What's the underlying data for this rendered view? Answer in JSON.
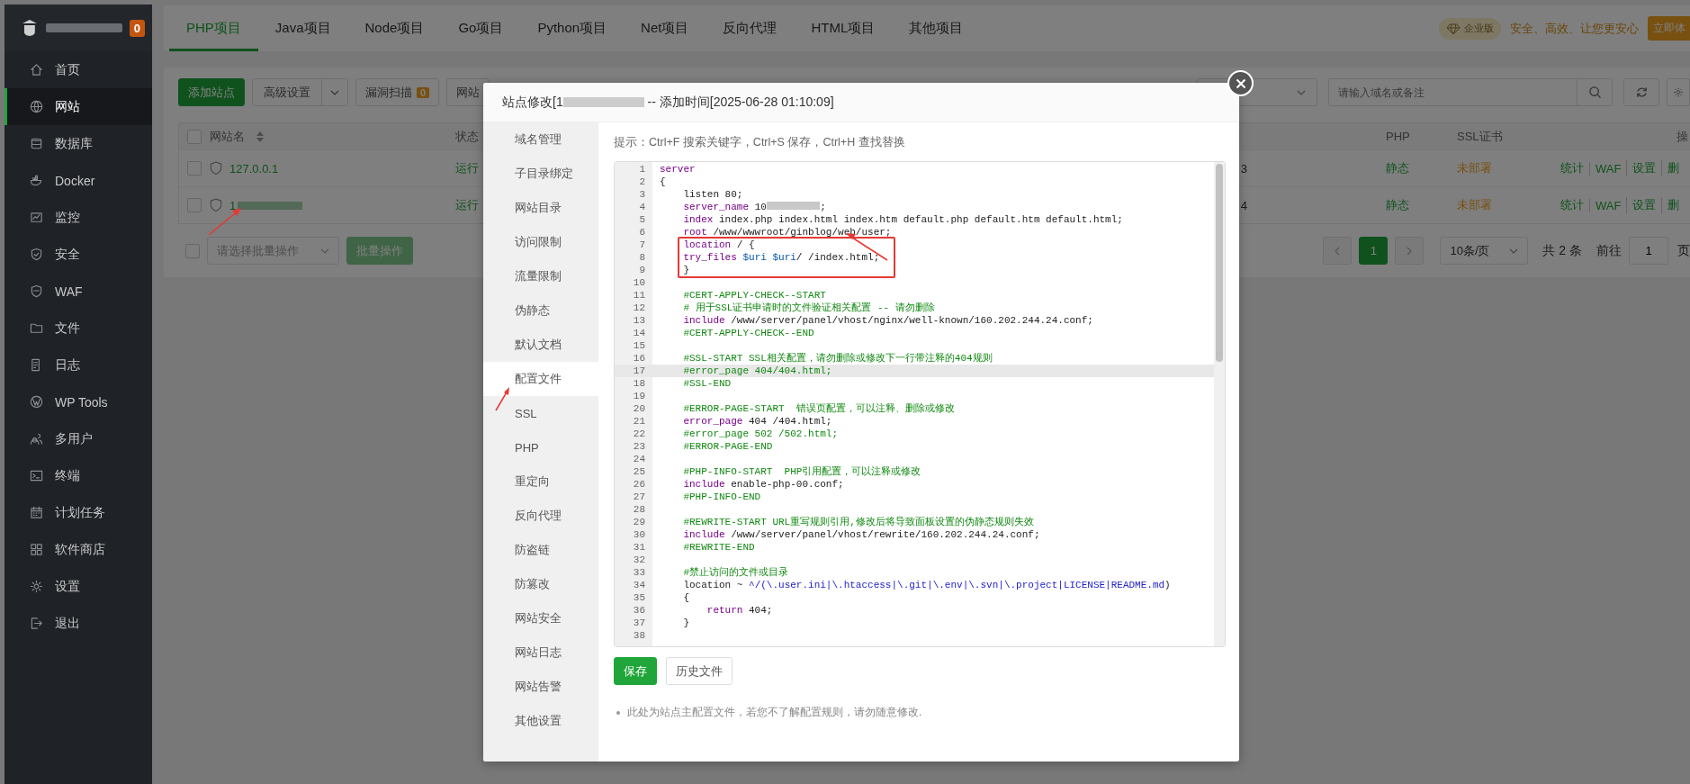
{
  "sidebar": {
    "badge": "0",
    "items": [
      {
        "label": "首页",
        "selected": false
      },
      {
        "label": "网站",
        "selected": true
      },
      {
        "label": "数据库",
        "selected": false
      },
      {
        "label": "Docker",
        "selected": false
      },
      {
        "label": "监控",
        "selected": false
      },
      {
        "label": "安全",
        "selected": false
      },
      {
        "label": "WAF",
        "selected": false
      },
      {
        "label": "文件",
        "selected": false
      },
      {
        "label": "日志",
        "selected": false
      },
      {
        "label": "WP Tools",
        "selected": false
      },
      {
        "label": "多用户",
        "selected": false
      },
      {
        "label": "终端",
        "selected": false
      },
      {
        "label": "计划任务",
        "selected": false
      },
      {
        "label": "软件商店",
        "selected": false
      },
      {
        "label": "设置",
        "selected": false
      },
      {
        "label": "退出",
        "selected": false
      }
    ]
  },
  "project_tabs": [
    {
      "label": "PHP项目",
      "selected": true
    },
    {
      "label": "Java项目",
      "selected": false
    },
    {
      "label": "Node项目",
      "selected": false
    },
    {
      "label": "Go项目",
      "selected": false
    },
    {
      "label": "Python项目",
      "selected": false
    },
    {
      "label": "Net项目",
      "selected": false
    },
    {
      "label": "反向代理",
      "selected": false
    },
    {
      "label": "HTML项目",
      "selected": false
    },
    {
      "label": "其他项目",
      "selected": false
    }
  ],
  "promo": {
    "badge": "企业版",
    "text": "安全、高效、让您更安心",
    "button": "立即体"
  },
  "toolbar": {
    "add_button": "添加站点",
    "advanced_button": "高级设置",
    "scan_button": "漏洞扫描",
    "scan_count": "0",
    "site_button": "网站",
    "search": {
      "placeholder": "请输入域名或备注"
    }
  },
  "table": {
    "select_all": {
      "checked": false
    },
    "columns": {
      "name": "网站名",
      "status": "状态",
      "php": "PHP",
      "ssl": "SSL证书",
      "actions": "操"
    },
    "rows": [
      {
        "checked": false,
        "name": "127.0.0.1",
        "name_redacted": false,
        "status": "运行",
        "column_4": "3",
        "php": "静态",
        "ssl": "未部署",
        "actions": [
          "统计",
          "WAF",
          "设置",
          "删"
        ]
      },
      {
        "checked": false,
        "name": "1",
        "name_redacted": true,
        "status": "运行",
        "column_4": "4",
        "php": "静态",
        "ssl": "未部署",
        "actions": [
          "统计",
          "WAF",
          "设置",
          "删"
        ]
      }
    ]
  },
  "batch": {
    "checked": false,
    "placeholder": "请选择批量操作",
    "button": "批量操作"
  },
  "pagination": {
    "pages": [
      {
        "label": "1",
        "selected": true
      }
    ],
    "page_size": "10条/页",
    "total": "共 2 条",
    "goto_label": "前往",
    "goto_value": "1",
    "page_suffix": "页"
  },
  "modal": {
    "title_prefix": "站点修改[1",
    "title_suffix": " -- 添加时间[2025-06-28 01:10:09]",
    "menu": [
      {
        "label": "域名管理",
        "selected": false
      },
      {
        "label": "子目录绑定",
        "selected": false
      },
      {
        "label": "网站目录",
        "selected": false
      },
      {
        "label": "访问限制",
        "selected": false
      },
      {
        "label": "流量限制",
        "selected": false
      },
      {
        "label": "伪静态",
        "selected": false
      },
      {
        "label": "默认文档",
        "selected": false
      },
      {
        "label": "配置文件",
        "selected": true
      },
      {
        "label": "SSL",
        "selected": false
      },
      {
        "label": "PHP",
        "selected": false
      },
      {
        "label": "重定向",
        "selected": false
      },
      {
        "label": "反向代理",
        "selected": false
      },
      {
        "label": "防盗链",
        "selected": false
      },
      {
        "label": "防篡改",
        "selected": false
      },
      {
        "label": "网站安全",
        "selected": false
      },
      {
        "label": "网站日志",
        "selected": false
      },
      {
        "label": "网站告警",
        "selected": false
      },
      {
        "label": "其他设置",
        "selected": false
      }
    ],
    "hint": "提示：Ctrl+F 搜索关键字，Ctrl+S 保存，Ctrl+H 查找替换",
    "code_lines": [
      {
        "number": "1",
        "active": false,
        "boxed": false,
        "tokens": [
          {
            "kind": "keyword",
            "text": "server"
          }
        ]
      },
      {
        "number": "2",
        "active": false,
        "boxed": false,
        "tokens": [
          {
            "kind": "plain",
            "text": "{"
          }
        ]
      },
      {
        "number": "3",
        "active": false,
        "boxed": false,
        "tokens": [
          {
            "kind": "plain",
            "text": "    listen 80;"
          }
        ]
      },
      {
        "number": "4",
        "active": false,
        "boxed": false,
        "tokens": [
          {
            "kind": "keyword",
            "text": "    server_name"
          },
          {
            "kind": "plain",
            "text": " 10"
          },
          {
            "kind": "redacted"
          },
          {
            "kind": "plain",
            "text": ";"
          }
        ]
      },
      {
        "number": "5",
        "active": false,
        "boxed": false,
        "tokens": [
          {
            "kind": "keyword",
            "text": "    index"
          },
          {
            "kind": "plain",
            "text": " index.php index.html index.htm default.php default.htm default.html;"
          }
        ]
      },
      {
        "number": "6",
        "active": false,
        "boxed": false,
        "tokens": [
          {
            "kind": "keyword",
            "text": "    root"
          },
          {
            "kind": "plain",
            "text": " /www/wwwroot/ginblog/web/user;"
          }
        ]
      },
      {
        "number": "7",
        "active": false,
        "boxed": true,
        "tokens": [
          {
            "kind": "keyword",
            "text": "    location"
          },
          {
            "kind": "plain",
            "text": " / {"
          }
        ]
      },
      {
        "number": "8",
        "active": false,
        "boxed": true,
        "tokens": [
          {
            "kind": "keyword",
            "text": "    try_files"
          },
          {
            "kind": "variable",
            "text": " $uri"
          },
          {
            "kind": "variable",
            "text": " $uri"
          },
          {
            "kind": "plain",
            "text": "/ /index.html;"
          }
        ]
      },
      {
        "number": "9",
        "active": false,
        "boxed": true,
        "tokens": [
          {
            "kind": "plain",
            "text": "    }"
          }
        ]
      },
      {
        "number": "10",
        "active": false,
        "boxed": false
      },
      {
        "number": "11",
        "active": false,
        "boxed": false,
        "tokens": [
          {
            "kind": "comment",
            "text": "    #CERT-APPLY-CHECK--START"
          }
        ]
      },
      {
        "number": "12",
        "active": false,
        "boxed": false,
        "tokens": [
          {
            "kind": "comment",
            "text": "    # 用于SSL证书申请时的文件验证相关配置 -- 请勿删除"
          }
        ]
      },
      {
        "number": "13",
        "active": false,
        "boxed": false,
        "tokens": [
          {
            "kind": "keyword",
            "text": "    include"
          },
          {
            "kind": "plain",
            "text": " /www/server/panel/vhost/nginx/well-known/160.202.244.24.conf;"
          }
        ]
      },
      {
        "number": "14",
        "active": false,
        "boxed": false,
        "tokens": [
          {
            "kind": "comment",
            "text": "    #CERT-APPLY-CHECK--END"
          }
        ]
      },
      {
        "number": "15",
        "active": false,
        "boxed": false
      },
      {
        "number": "16",
        "active": false,
        "boxed": false,
        "tokens": [
          {
            "kind": "comment",
            "text": "    #SSL-START SSL相关配置，请勿删除或修改下一行带注释的404规则"
          }
        ]
      },
      {
        "number": "17",
        "active": true,
        "boxed": false,
        "tokens": [
          {
            "kind": "comment",
            "text": "    #error_page 404/404.html;"
          }
        ]
      },
      {
        "number": "18",
        "active": false,
        "boxed": false,
        "tokens": [
          {
            "kind": "comment",
            "text": "    #SSL-END"
          }
        ]
      },
      {
        "number": "19",
        "active": false,
        "boxed": false
      },
      {
        "number": "20",
        "active": false,
        "boxed": false,
        "tokens": [
          {
            "kind": "comment",
            "text": "    #ERROR-PAGE-START  错误页配置，可以注释、删除或修改"
          }
        ]
      },
      {
        "number": "21",
        "active": false,
        "boxed": false,
        "tokens": [
          {
            "kind": "keyword",
            "text": "    error_page"
          },
          {
            "kind": "plain",
            "text": " 404 /404.html;"
          }
        ]
      },
      {
        "number": "22",
        "active": false,
        "boxed": false,
        "tokens": [
          {
            "kind": "comment",
            "text": "    #error_page 502 /502.html;"
          }
        ]
      },
      {
        "number": "23",
        "active": false,
        "boxed": false,
        "tokens": [
          {
            "kind": "comment",
            "text": "    #ERROR-PAGE-END"
          }
        ]
      },
      {
        "number": "24",
        "active": false,
        "boxed": false
      },
      {
        "number": "25",
        "active": false,
        "boxed": false,
        "tokens": [
          {
            "kind": "comment",
            "text": "    #PHP-INFO-START  PHP引用配置，可以注释或修改"
          }
        ]
      },
      {
        "number": "26",
        "active": false,
        "boxed": false,
        "tokens": [
          {
            "kind": "keyword",
            "text": "    include"
          },
          {
            "kind": "plain",
            "text": " enable-php-00.conf;"
          }
        ]
      },
      {
        "number": "27",
        "active": false,
        "boxed": false,
        "tokens": [
          {
            "kind": "comment",
            "text": "    #PHP-INFO-END"
          }
        ]
      },
      {
        "number": "28",
        "active": false,
        "boxed": false
      },
      {
        "number": "29",
        "active": false,
        "boxed": false,
        "tokens": [
          {
            "kind": "comment",
            "text": "    #REWRITE-START URL重写规则引用,修改后将导致面板设置的伪静态规则失效"
          }
        ]
      },
      {
        "number": "30",
        "active": false,
        "boxed": false,
        "tokens": [
          {
            "kind": "keyword",
            "text": "    include"
          },
          {
            "kind": "plain",
            "text": " /www/server/panel/vhost/rewrite/160.202.244.24.conf;"
          }
        ]
      },
      {
        "number": "31",
        "active": false,
        "boxed": false,
        "tokens": [
          {
            "kind": "comment",
            "text": "    #REWRITE-END"
          }
        ]
      },
      {
        "number": "32",
        "active": false,
        "boxed": false
      },
      {
        "number": "33",
        "active": false,
        "boxed": false,
        "tokens": [
          {
            "kind": "comment",
            "text": "    #禁止访问的文件或目录"
          }
        ]
      },
      {
        "number": "34",
        "active": false,
        "boxed": false,
        "tokens": [
          {
            "kind": "plain",
            "text": "    location ~ "
          },
          {
            "kind": "regex",
            "text": "^/(\\.user.ini|\\.htaccess|\\.git|\\.env|\\.svn|\\.project|LICENSE|README.md"
          },
          {
            "kind": "plain",
            "text": ")"
          }
        ]
      },
      {
        "number": "35",
        "active": false,
        "boxed": false,
        "tokens": [
          {
            "kind": "plain",
            "text": "    {"
          }
        ]
      },
      {
        "number": "36",
        "active": false,
        "boxed": false,
        "tokens": [
          {
            "kind": "keyword",
            "text": "        return"
          },
          {
            "kind": "plain",
            "text": " 404;"
          }
        ]
      },
      {
        "number": "37",
        "active": false,
        "boxed": false,
        "tokens": [
          {
            "kind": "plain",
            "text": "    }"
          }
        ]
      },
      {
        "number": "38",
        "active": false,
        "boxed": false
      }
    ],
    "save_button": "保存",
    "history_button": "历史文件",
    "notes": [
      "此处为站点主配置文件，若您不了解配置规则，请勿随意修改."
    ]
  }
}
